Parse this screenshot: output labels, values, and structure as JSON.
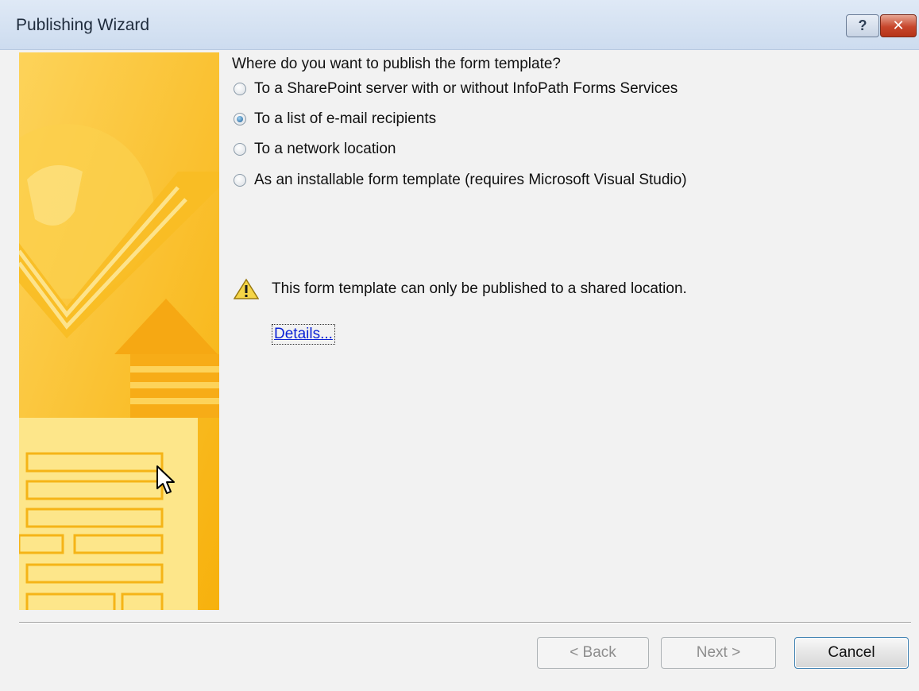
{
  "window": {
    "title": "Publishing Wizard",
    "help_label": "?",
    "close_label": "✕"
  },
  "question": "Where do you want to publish the form template?",
  "options": [
    {
      "label": "To a SharePoint server with or without InfoPath Forms Services",
      "checked": false
    },
    {
      "label": "To a list of e-mail recipients",
      "checked": true
    },
    {
      "label": "To a network location",
      "checked": false
    },
    {
      "label": "As an installable form template (requires Microsoft Visual Studio)",
      "checked": false
    }
  ],
  "warning": {
    "icon": "warning-icon",
    "text": "This form template can only be published to a shared location."
  },
  "details_link": "Details...",
  "buttons": {
    "back": "< Back",
    "next": "Next >",
    "cancel": "Cancel"
  },
  "colors": {
    "banner": "#fbc62a",
    "link": "#0b22d6",
    "close_button": "#c7462b"
  }
}
